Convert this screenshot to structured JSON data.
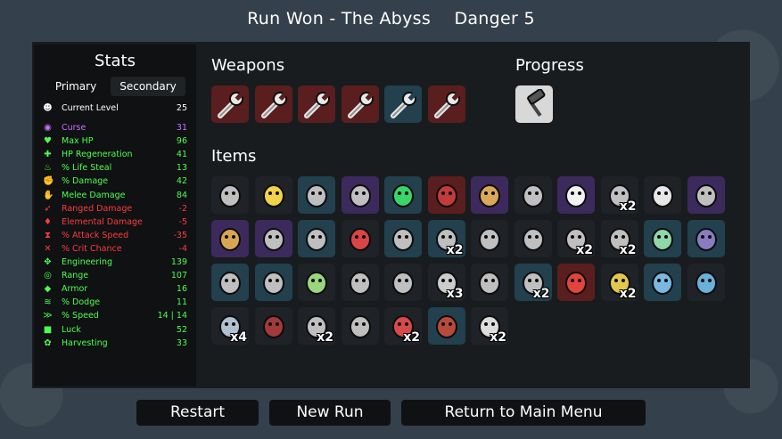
{
  "header": {
    "title": "Run Won - The Abyss",
    "danger": "Danger 5"
  },
  "stats": {
    "title": "Stats",
    "tabs": {
      "primary": "Primary",
      "secondary": "Secondary"
    },
    "rows": [
      {
        "label": "Current Level",
        "value": "25",
        "color": "#ffffff",
        "icon": "level-icon"
      },
      {
        "label": "Curse",
        "value": "31",
        "color": "#c572ff",
        "icon": "curse-icon"
      },
      {
        "label": "Max HP",
        "value": "96",
        "color": "#4dff4d",
        "icon": "heart-icon"
      },
      {
        "label": "HP Regeneration",
        "value": "41",
        "color": "#4dff4d",
        "icon": "regen-icon"
      },
      {
        "label": "% Life Steal",
        "value": "13",
        "color": "#4dff4d",
        "icon": "life-steal-icon"
      },
      {
        "label": "% Damage",
        "value": "42",
        "color": "#4dff4d",
        "icon": "damage-icon"
      },
      {
        "label": "Melee Damage",
        "value": "84",
        "color": "#4dff4d",
        "icon": "melee-icon"
      },
      {
        "label": "Ranged Damage",
        "value": "-2",
        "color": "#ff3b3b",
        "icon": "ranged-icon"
      },
      {
        "label": "Elemental Damage",
        "value": "-5",
        "color": "#ff3b3b",
        "icon": "elemental-icon"
      },
      {
        "label": "% Attack Speed",
        "value": "-35",
        "color": "#ff3b3b",
        "icon": "attack-speed-icon"
      },
      {
        "label": "% Crit Chance",
        "value": "-4",
        "color": "#ff3b3b",
        "icon": "crit-icon"
      },
      {
        "label": "Engineering",
        "value": "139",
        "color": "#4dff4d",
        "icon": "engineering-icon"
      },
      {
        "label": "Range",
        "value": "107",
        "color": "#4dff4d",
        "icon": "range-icon"
      },
      {
        "label": "Armor",
        "value": "16",
        "color": "#4dff4d",
        "icon": "armor-icon"
      },
      {
        "label": "% Dodge",
        "value": "11",
        "color": "#4dff4d",
        "icon": "dodge-icon"
      },
      {
        "label": "% Speed",
        "value": "14 | 14",
        "color": "#4dff4d",
        "icon": "speed-icon"
      },
      {
        "label": "Luck",
        "value": "52",
        "color": "#4dff4d",
        "icon": "luck-icon"
      },
      {
        "label": "Harvesting",
        "value": "33",
        "color": "#4dff4d",
        "icon": "harvesting-icon"
      }
    ]
  },
  "weapons": {
    "title": "Weapons",
    "slots": [
      {
        "icon": "wrench-icon",
        "tier": "red"
      },
      {
        "icon": "wrench-icon",
        "tier": "red"
      },
      {
        "icon": "wrench-icon",
        "tier": "red"
      },
      {
        "icon": "wrench-icon",
        "tier": "red"
      },
      {
        "icon": "wrench-icon",
        "tier": "blue"
      },
      {
        "icon": "wrench-icon",
        "tier": "red"
      }
    ]
  },
  "progress": {
    "title": "Progress",
    "slots": [
      {
        "icon": "hammer-icon",
        "tier": "white"
      }
    ]
  },
  "items": {
    "title": "Items",
    "slots": [
      {
        "icon": "mask-icon",
        "tier": "grey",
        "count": ""
      },
      {
        "icon": "bee-icon",
        "tier": "grey",
        "count": ""
      },
      {
        "icon": "lightning-icon",
        "tier": "blue",
        "count": ""
      },
      {
        "icon": "bottle-icon",
        "tier": "purple",
        "count": ""
      },
      {
        "icon": "flask-icon",
        "tier": "blue",
        "count": ""
      },
      {
        "icon": "cape-icon",
        "tier": "red",
        "count": ""
      },
      {
        "icon": "wheat-icon",
        "tier": "purple",
        "count": ""
      },
      {
        "icon": "hook-icon",
        "tier": "grey",
        "count": ""
      },
      {
        "icon": "egg-icon",
        "tier": "purple",
        "count": ""
      },
      {
        "icon": "target-icon",
        "tier": "grey",
        "count": "x2"
      },
      {
        "icon": "worm-icon",
        "tier": "grey",
        "count": ""
      },
      {
        "icon": "claw-icon",
        "tier": "purple",
        "count": ""
      },
      {
        "icon": "cauldron-icon",
        "tier": "purple",
        "count": ""
      },
      {
        "icon": "spell-icon",
        "tier": "purple",
        "count": ""
      },
      {
        "icon": "amulet-icon",
        "tier": "blue",
        "count": ""
      },
      {
        "icon": "lighthouse-icon",
        "tier": "grey",
        "count": ""
      },
      {
        "icon": "wheelbarrow-icon",
        "tier": "blue",
        "count": ""
      },
      {
        "icon": "crane-icon",
        "tier": "blue",
        "count": "x2"
      },
      {
        "icon": "axe-icon",
        "tier": "grey",
        "count": ""
      },
      {
        "icon": "blood-icon",
        "tier": "grey",
        "count": ""
      },
      {
        "icon": "pod-icon",
        "tier": "grey",
        "count": "x2"
      },
      {
        "icon": "helmet-icon",
        "tier": "grey",
        "count": "x2"
      },
      {
        "icon": "chameleon-icon",
        "tier": "blue",
        "count": ""
      },
      {
        "icon": "alien-icon",
        "tier": "blue",
        "count": ""
      },
      {
        "icon": "turret-icon",
        "tier": "blue",
        "count": ""
      },
      {
        "icon": "spyglass-icon",
        "tier": "blue",
        "count": ""
      },
      {
        "icon": "potion-icon",
        "tier": "grey",
        "count": ""
      },
      {
        "icon": "skull-icon",
        "tier": "grey",
        "count": ""
      },
      {
        "icon": "pirate-icon",
        "tier": "grey",
        "count": ""
      },
      {
        "icon": "scythe-icon",
        "tier": "grey",
        "count": "x3"
      },
      {
        "icon": "lizard-icon",
        "tier": "grey",
        "count": ""
      },
      {
        "icon": "wrench-robot-icon",
        "tier": "blue",
        "count": "x2"
      },
      {
        "icon": "tomato-icon",
        "tier": "red",
        "count": ""
      },
      {
        "icon": "propeller-hat-icon",
        "tier": "grey",
        "count": "x2"
      },
      {
        "icon": "jar-icon",
        "tier": "blue",
        "count": ""
      },
      {
        "icon": "fish-icon",
        "tier": "grey",
        "count": ""
      },
      {
        "icon": "plank-icon",
        "tier": "grey",
        "count": "x4"
      },
      {
        "icon": "shirt-icon",
        "tier": "grey",
        "count": ""
      },
      {
        "icon": "scroll-icon",
        "tier": "grey",
        "count": "x2"
      },
      {
        "icon": "spider-icon",
        "tier": "grey",
        "count": ""
      },
      {
        "icon": "dagger-icon",
        "tier": "grey",
        "count": "x2"
      },
      {
        "icon": "banner-icon",
        "tier": "blue",
        "count": ""
      },
      {
        "icon": "crescent-icon",
        "tier": "grey",
        "count": "x2"
      }
    ]
  },
  "buttons": {
    "restart": "Restart",
    "new_run": "New Run",
    "main_menu": "Return to Main Menu"
  },
  "colors": {
    "grey": "#1f2226",
    "blue": "#22404e",
    "purple": "#3c2a5c",
    "red": "#5a1e1e",
    "white": "#d8d8d8"
  }
}
